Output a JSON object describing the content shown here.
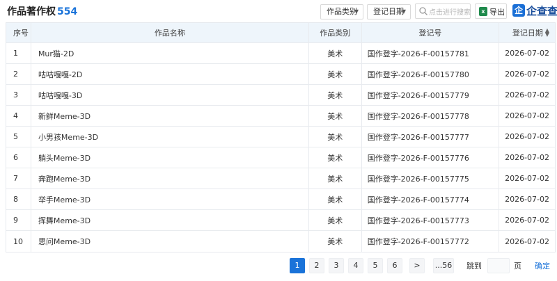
{
  "header": {
    "title": "作品著作权",
    "count": "554",
    "category_dropdown": "作品类别",
    "date_dropdown": "登记日期",
    "search_placeholder": "点击进行搜索",
    "export_label": "导出",
    "brand_logo": "企",
    "brand_name": "企查查"
  },
  "table": {
    "columns": [
      "序号",
      "作品名称",
      "作品类别",
      "登记号",
      "登记日期"
    ],
    "rows": [
      {
        "no": "1",
        "name": "Mur猫-2D",
        "category": "美术",
        "reg_no": "国作登字-2026-F-00157781",
        "date": "2026-07-02"
      },
      {
        "no": "2",
        "name": "咕咕嘎嘎-2D",
        "category": "美术",
        "reg_no": "国作登字-2026-F-00157780",
        "date": "2026-07-02"
      },
      {
        "no": "3",
        "name": "咕咕嘎嘎-3D",
        "category": "美术",
        "reg_no": "国作登字-2026-F-00157779",
        "date": "2026-07-02"
      },
      {
        "no": "4",
        "name": "新鲜Meme-3D",
        "category": "美术",
        "reg_no": "国作登字-2026-F-00157778",
        "date": "2026-07-02"
      },
      {
        "no": "5",
        "name": "小男孩Meme-3D",
        "category": "美术",
        "reg_no": "国作登字-2026-F-00157777",
        "date": "2026-07-02"
      },
      {
        "no": "6",
        "name": "躺头Meme-3D",
        "category": "美术",
        "reg_no": "国作登字-2026-F-00157776",
        "date": "2026-07-02"
      },
      {
        "no": "7",
        "name": "奔跑Meme-3D",
        "category": "美术",
        "reg_no": "国作登字-2026-F-00157775",
        "date": "2026-07-02"
      },
      {
        "no": "8",
        "name": "举手Meme-3D",
        "category": "美术",
        "reg_no": "国作登字-2026-F-00157774",
        "date": "2026-07-02"
      },
      {
        "no": "9",
        "name": "挥舞Meme-3D",
        "category": "美术",
        "reg_no": "国作登字-2026-F-00157773",
        "date": "2026-07-02"
      },
      {
        "no": "10",
        "name": "思问Meme-3D",
        "category": "美术",
        "reg_no": "国作登字-2026-F-00157772",
        "date": "2026-07-02"
      }
    ]
  },
  "pagination": {
    "pages": [
      "1",
      "2",
      "3",
      "4",
      "5",
      "6"
    ],
    "current": "1",
    "next": ">",
    "last": "...56",
    "jump_label": "跳到",
    "page_unit": "页",
    "confirm": "确定"
  },
  "colors": {
    "accent": "#1a73d9",
    "header_bg": "#eef5fb"
  }
}
